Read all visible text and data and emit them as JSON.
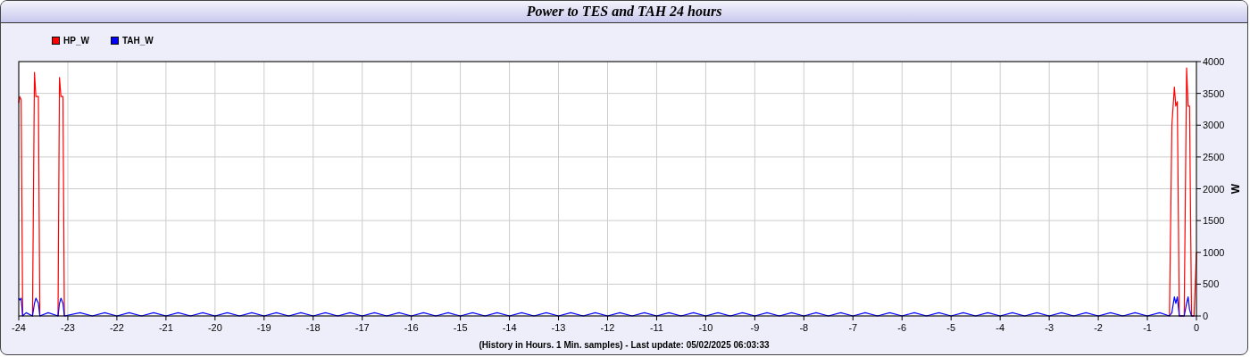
{
  "chart_data": {
    "type": "line",
    "grid": true,
    "title": "Power to TES and TAH 24 hours",
    "xlabel": "(History in Hours. 1 Min. samples) - Last update: 05/02/2025 06:03:33",
    "ylabel": "W",
    "xlim": [
      -24,
      0
    ],
    "ylim": [
      0,
      4000
    ],
    "xticks": [
      -24,
      -23,
      -22,
      -21,
      -20,
      -19,
      -18,
      -17,
      -16,
      -15,
      -14,
      -13,
      -12,
      -11,
      -10,
      -9,
      -8,
      -7,
      -6,
      -5,
      -4,
      -3,
      -2,
      -1,
      0
    ],
    "yticks": [
      0,
      500,
      1000,
      1500,
      2000,
      2500,
      3000,
      3500,
      4000
    ],
    "x": [
      -24,
      -23.98,
      -23.95,
      -23.92,
      -23.85,
      -23.72,
      -23.68,
      -23.65,
      -23.6,
      -23.57,
      -23.4,
      -23.2,
      -23.17,
      -23.14,
      -23.1,
      -23.07,
      -22.75,
      -22.5,
      -22.25,
      -22,
      -21.75,
      -21.5,
      -21.25,
      -21,
      -20.75,
      -20.5,
      -20.25,
      -20,
      -19.75,
      -19.5,
      -19.25,
      -19,
      -18.75,
      -18.5,
      -18.25,
      -18,
      -17.75,
      -17.5,
      -17.25,
      -17,
      -16.75,
      -16.5,
      -16.25,
      -16,
      -15.75,
      -15.5,
      -15.25,
      -15,
      -14.75,
      -14.5,
      -14.25,
      -14,
      -13.75,
      -13.5,
      -13.25,
      -13,
      -12.75,
      -12.5,
      -12.25,
      -12,
      -11.75,
      -11.5,
      -11.25,
      -11,
      -10.75,
      -10.5,
      -10.25,
      -10,
      -9.75,
      -9.5,
      -9.25,
      -9,
      -8.75,
      -8.5,
      -8.25,
      -8,
      -7.75,
      -7.5,
      -7.25,
      -7,
      -6.75,
      -6.5,
      -6.25,
      -6,
      -5.75,
      -5.5,
      -5.25,
      -5,
      -4.75,
      -4.5,
      -4.25,
      -4,
      -3.75,
      -3.5,
      -3.25,
      -3,
      -2.75,
      -2.5,
      -2.25,
      -2,
      -1.75,
      -1.5,
      -1.25,
      -1,
      -0.75,
      -0.55,
      -0.5,
      -0.45,
      -0.42,
      -0.39,
      -0.35,
      -0.25,
      -0.2,
      -0.17,
      -0.14,
      -0.1,
      -0.05,
      0
    ],
    "series": [
      {
        "name": "HP_W",
        "color": "#ff0000",
        "values": [
          3350,
          3450,
          3400,
          0,
          null,
          0,
          3830,
          3450,
          3450,
          0,
          null,
          0,
          3750,
          3450,
          3450,
          0,
          null,
          null,
          null,
          null,
          null,
          null,
          null,
          null,
          null,
          null,
          null,
          null,
          null,
          null,
          null,
          null,
          null,
          null,
          null,
          null,
          null,
          null,
          null,
          null,
          null,
          null,
          null,
          null,
          null,
          null,
          null,
          null,
          null,
          null,
          null,
          null,
          null,
          null,
          null,
          null,
          null,
          null,
          null,
          null,
          null,
          null,
          null,
          null,
          null,
          null,
          null,
          null,
          null,
          null,
          null,
          null,
          null,
          null,
          null,
          null,
          null,
          null,
          null,
          null,
          null,
          null,
          null,
          null,
          null,
          null,
          null,
          null,
          null,
          null,
          null,
          null,
          null,
          null,
          null,
          null,
          null,
          null,
          null,
          null,
          null,
          null,
          null,
          null,
          null,
          0,
          3000,
          3600,
          3300,
          3370,
          0,
          0,
          3900,
          3300,
          3300,
          0,
          0,
          1000
        ]
      },
      {
        "name": "TAH_W",
        "color": "#0000ff",
        "values": [
          280,
          250,
          280,
          0,
          50,
          0,
          200,
          280,
          200,
          0,
          50,
          0,
          200,
          280,
          200,
          0,
          50,
          0,
          50,
          0,
          50,
          0,
          50,
          0,
          50,
          0,
          50,
          0,
          50,
          0,
          50,
          0,
          50,
          0,
          50,
          0,
          50,
          0,
          50,
          0,
          50,
          0,
          50,
          0,
          50,
          0,
          50,
          0,
          50,
          0,
          50,
          0,
          50,
          0,
          50,
          0,
          50,
          0,
          50,
          0,
          50,
          0,
          50,
          0,
          50,
          0,
          50,
          0,
          50,
          0,
          50,
          0,
          50,
          0,
          50,
          0,
          50,
          0,
          50,
          0,
          50,
          0,
          50,
          0,
          50,
          0,
          50,
          0,
          50,
          0,
          50,
          0,
          50,
          0,
          50,
          0,
          50,
          0,
          50,
          0,
          50,
          0,
          50,
          0,
          50,
          0,
          50,
          300,
          200,
          300,
          0,
          0,
          200,
          300,
          100,
          0,
          0,
          null
        ]
      }
    ]
  }
}
